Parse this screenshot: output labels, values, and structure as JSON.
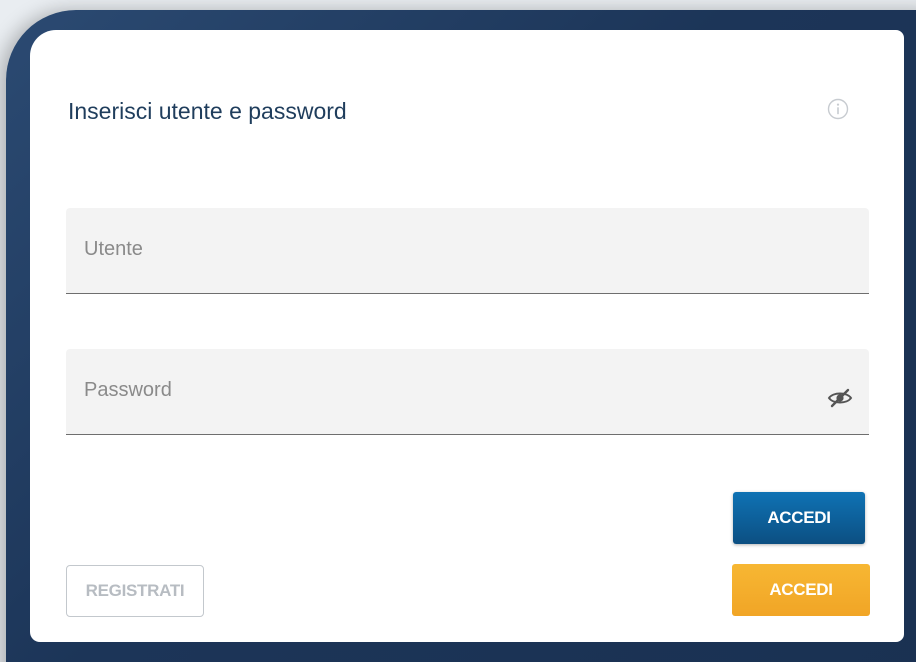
{
  "login": {
    "title": "Inserisci utente e password",
    "info_icon": "info-circle-icon",
    "username": {
      "placeholder": "Utente",
      "value": ""
    },
    "password": {
      "placeholder": "Password",
      "value": "",
      "toggle_icon": "eye-slash-icon"
    },
    "buttons": {
      "primary_label": "ACCEDI",
      "secondary_label": "ACCEDI",
      "register_label": "REGISTRATI"
    }
  },
  "colors": {
    "frame": "#1c3558",
    "title": "#1f3d5c",
    "primary_button": "#0d5f99",
    "secondary_button": "#f1a526",
    "register_border": "#c3c8cd",
    "field_bg": "#f3f3f3"
  }
}
